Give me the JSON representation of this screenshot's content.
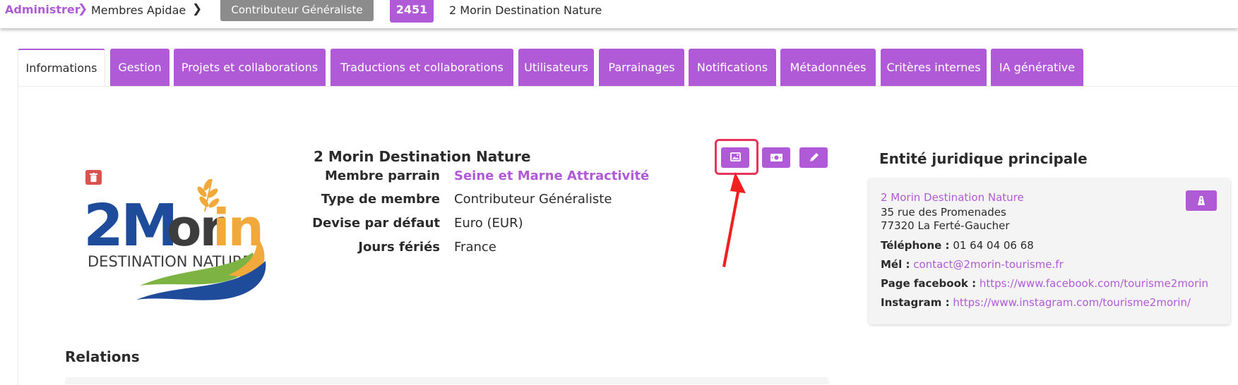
{
  "breadcrumb": {
    "admin": "Administrer",
    "members": "Membres Apidae"
  },
  "header": {
    "member_type_badge": "Contributeur Généraliste",
    "member_id": "2451",
    "member_name": "2 Morin Destination Nature"
  },
  "tabs": [
    {
      "label": "Informations",
      "active": true
    },
    {
      "label": "Gestion"
    },
    {
      "label": "Projets et collaborations"
    },
    {
      "label": "Traductions et collaborations"
    },
    {
      "label": "Utilisateurs"
    },
    {
      "label": "Parrainages"
    },
    {
      "label": "Notifications"
    },
    {
      "label": "Métadonnées"
    },
    {
      "label": "Critères internes"
    },
    {
      "label": "IA générative"
    }
  ],
  "logo": {
    "text_main": "2Morin",
    "text_sub": "Destination Nature"
  },
  "member": {
    "name": "2 Morin Destination Nature",
    "fields": [
      {
        "label": "Membre parrain",
        "value": "Seine et Marne Attractivité",
        "link": true
      },
      {
        "label": "Type de membre",
        "value": "Contributeur Généraliste"
      },
      {
        "label": "Devise par défaut",
        "value": "Euro (EUR)"
      },
      {
        "label": "Jours fériés",
        "value": "France"
      }
    ],
    "actions": [
      "image-icon",
      "money-icon",
      "pencil-icon"
    ]
  },
  "legal": {
    "title": "Entité juridique principale",
    "name": "2 Morin Destination Nature",
    "address1": "35 rue des Promenades",
    "address2": "77320 La Ferté-Gaucher",
    "phone_label": "Téléphone :",
    "phone": "01 64 04 06 68",
    "email_label": "Mél :",
    "email": "contact@2morin-tourisme.fr",
    "facebook_label": "Page facebook :",
    "facebook": "https://www.facebook.com/tourisme2morin",
    "instagram_label": "Instagram :",
    "instagram": "https://www.instagram.com/tourisme2morin/"
  },
  "relations": {
    "title": "Relations"
  },
  "colors": {
    "accent": "#b05ad8",
    "badge_grey": "#8c8c8c",
    "danger": "#d9534f",
    "highlight": "#e8335a"
  }
}
